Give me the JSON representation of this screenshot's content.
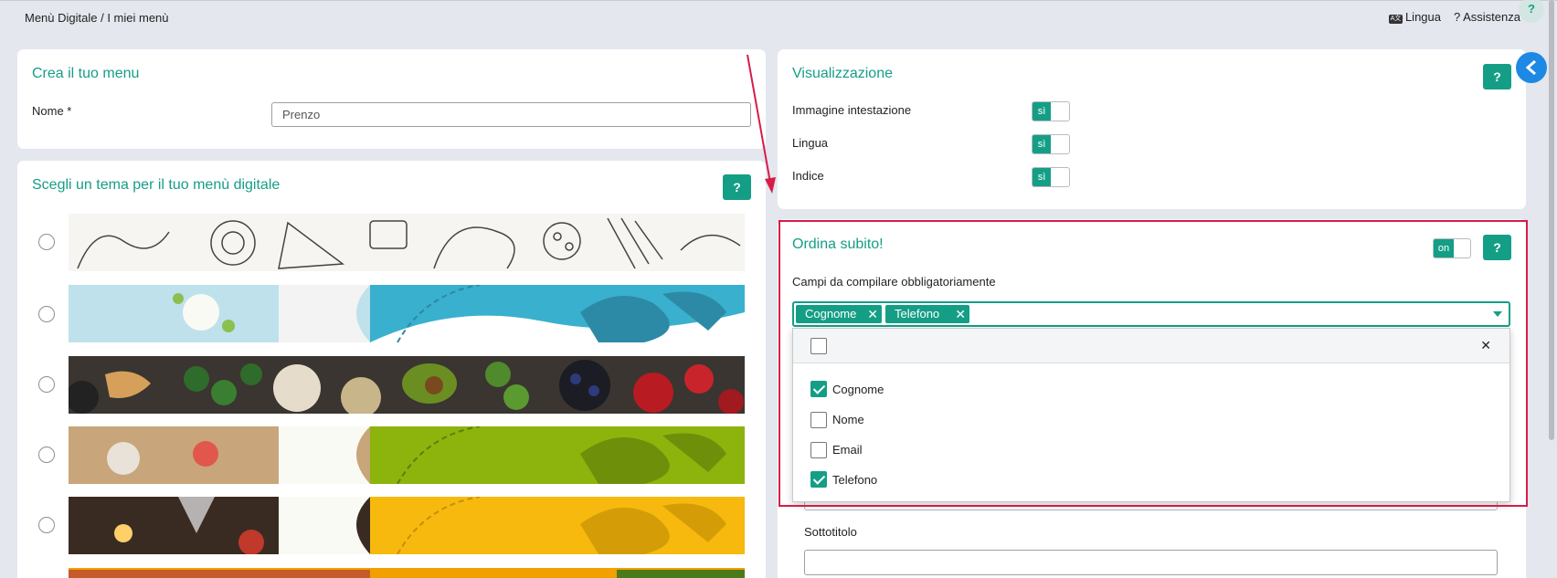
{
  "topbar": {
    "breadcrumb": "Menù Digitale / I miei menù",
    "language_label": "Lingua",
    "assistance_label": "Assistenza",
    "help_fab": "?"
  },
  "create_menu": {
    "title": "Crea il tuo menu",
    "name_label": "Nome *",
    "name_value": "Prenzo"
  },
  "theme": {
    "title": "Scegli un tema per il tuo menù digitale",
    "help": "?"
  },
  "display": {
    "title": "Visualizzazione",
    "help": "?",
    "options": [
      {
        "label": "Immagine intestazione",
        "toggle": "sì"
      },
      {
        "label": "Lingua",
        "toggle": "sì"
      },
      {
        "label": "Indice",
        "toggle": "sì"
      }
    ]
  },
  "order_now": {
    "title": "Ordina subito!",
    "toggle": "on",
    "help": "?",
    "required_fields_label": "Campi da compilare obbligatoriamente",
    "selected_chips": [
      "Cognome",
      "Telefono"
    ],
    "chip_remove": "✕",
    "close_glyph": "✕",
    "options": [
      {
        "label": "Cognome",
        "checked": true
      },
      {
        "label": "Nome",
        "checked": false
      },
      {
        "label": "Email",
        "checked": false
      },
      {
        "label": "Telefono",
        "checked": true
      }
    ]
  },
  "subtitle": {
    "label": "Sottotitolo",
    "value": ""
  },
  "colors": {
    "accent": "#159e86",
    "annotation": "#d81b48",
    "side_toggle": "#1e88e5"
  }
}
